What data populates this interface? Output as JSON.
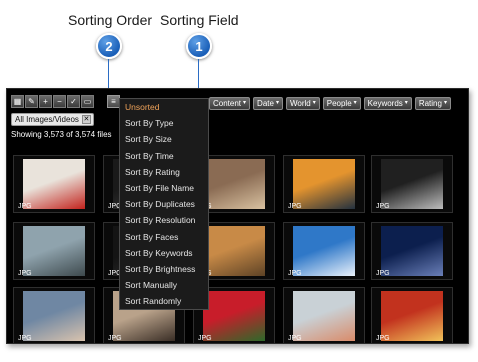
{
  "callouts": [
    {
      "number": "2",
      "label": "Sorting Order"
    },
    {
      "number": "1",
      "label": "Sorting Field"
    }
  ],
  "toolbar": {
    "buttons": [
      {
        "icon": "grid-icon",
        "glyph": "▦"
      },
      {
        "icon": "pencil-icon",
        "glyph": "✎"
      },
      {
        "icon": "plus-icon",
        "glyph": "+"
      },
      {
        "icon": "minus-icon",
        "glyph": "−"
      },
      {
        "icon": "check-icon",
        "glyph": "✓"
      },
      {
        "icon": "folder-icon",
        "glyph": "▭"
      }
    ],
    "sort_order_glyph": "≡"
  },
  "filters": [
    {
      "label": "Content",
      "chevron": "▾"
    },
    {
      "label": "Date",
      "chevron": "▾"
    },
    {
      "label": "World",
      "chevron": "▾"
    },
    {
      "label": "People",
      "chevron": "▾"
    },
    {
      "label": "Keywords",
      "chevron": "▾"
    },
    {
      "label": "Rating",
      "chevron": "▾"
    }
  ],
  "tag": {
    "label": "All Images/Videos",
    "close": "✕"
  },
  "status": "Showing 3,573 of 3,574 files",
  "sort_menu": {
    "selected_index": 0,
    "items": [
      "Unsorted",
      "Sort By Type",
      "Sort By Size",
      "Sort By Time",
      "Sort By Rating",
      "Sort By File Name",
      "Sort By Duplicates",
      "Sort By Resolution",
      "Sort By Faces",
      "Sort By Keywords",
      "Sort By Brightness",
      "Sort Manually",
      "Sort Randomly"
    ]
  },
  "thumbnails": [
    {
      "label": "JPG",
      "subject": "product-box",
      "colors": [
        "#e9e3db",
        "#c2221c"
      ]
    },
    {
      "label": "JPG",
      "subject": "dark-scene",
      "colors": [
        "#1a1a1a",
        "#3a3a3a"
      ]
    },
    {
      "label": "JPG",
      "subject": "town-street",
      "colors": [
        "#8a6b53",
        "#d9c2a1"
      ]
    },
    {
      "label": "JPG",
      "subject": "sunset-sea",
      "colors": [
        "#e4942e",
        "#23313f"
      ]
    },
    {
      "label": "JPG",
      "subject": "guitarist",
      "colors": [
        "#202020",
        "#bdbdbd"
      ]
    },
    {
      "label": "JPG",
      "subject": "harbor-boats",
      "colors": [
        "#8fa3ad",
        "#3e4a4e"
      ]
    },
    {
      "label": "JPG",
      "subject": "dark-scene",
      "colors": [
        "#141414",
        "#2e2e2e"
      ]
    },
    {
      "label": "JPG",
      "subject": "dog",
      "colors": [
        "#c88a47",
        "#5e4326"
      ]
    },
    {
      "label": "JPG",
      "subject": "blue-sky-clouds",
      "colors": [
        "#2f78c8",
        "#eaf2fb"
      ]
    },
    {
      "label": "JPG",
      "subject": "night-city",
      "colors": [
        "#0c1f4e",
        "#6a7fb8"
      ]
    },
    {
      "label": "JPG",
      "subject": "child-portrait",
      "colors": [
        "#6f87a3",
        "#d9c3ae"
      ]
    },
    {
      "label": "JPG",
      "subject": "family-photo",
      "colors": [
        "#b9a28a",
        "#3a2e26"
      ]
    },
    {
      "label": "JPG",
      "subject": "red-tulips",
      "colors": [
        "#c81d2a",
        "#2d6a2a"
      ]
    },
    {
      "label": "JPG",
      "subject": "woman-portrait",
      "colors": [
        "#c9d1d6",
        "#d98b6a"
      ]
    },
    {
      "label": "JPG",
      "subject": "subway-train",
      "colors": [
        "#c2321e",
        "#f1c35a"
      ]
    }
  ]
}
